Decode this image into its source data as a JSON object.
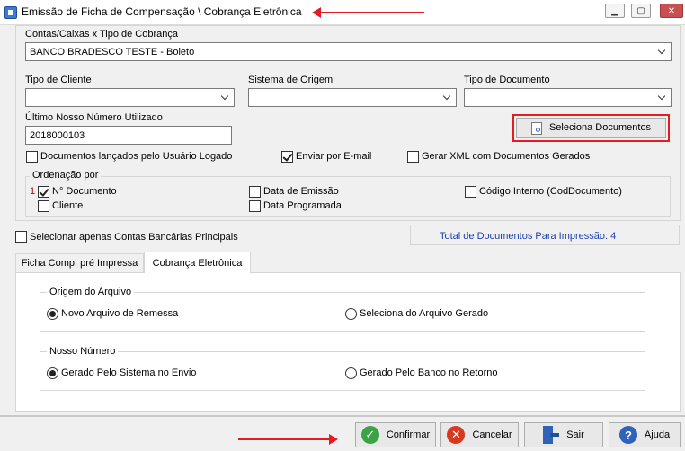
{
  "window": {
    "title": "Emissão de Ficha de Compensação \\ Cobrança Eletrônica",
    "minimize": "▭",
    "maximize": "□",
    "close": "✕"
  },
  "contas": {
    "label": "Contas/Caixas x Tipo de Cobrança",
    "value": "BANCO BRADESCO TESTE - Boleto"
  },
  "filters": {
    "tipo_cliente": {
      "label": "Tipo de Cliente",
      "value": ""
    },
    "sistema_origem": {
      "label": "Sistema de Origem",
      "value": ""
    },
    "tipo_documento": {
      "label": "Tipo de Documento",
      "value": ""
    }
  },
  "ultimo_nosso_numero": {
    "label": "Último Nosso Número Utilizado",
    "value": "2018000103"
  },
  "seleciona_documentos": "Seleciona Documentos",
  "options": {
    "docs_usuario": {
      "label": "Documentos lançados pelo Usuário Logado",
      "checked": false
    },
    "enviar_email": {
      "label": "Enviar por E-mail",
      "checked": true
    },
    "gerar_xml": {
      "label": "Gerar XML com Documentos Gerados",
      "checked": false
    }
  },
  "ordenacao": {
    "label": "Ordenação por",
    "order_index": "1",
    "items": [
      {
        "label": "N° Documento",
        "checked": true
      },
      {
        "label": "Data de Emissão",
        "checked": false
      },
      {
        "label": "Código Interno (CodDocumento)",
        "checked": false
      },
      {
        "label": "Cliente",
        "checked": false
      },
      {
        "label": "Data Programada",
        "checked": false
      }
    ]
  },
  "contas_principais": {
    "label": "Selecionar apenas Contas Bancárias Principais",
    "checked": false
  },
  "total_docs": "Total de Documentos Para Impressão: 4",
  "tabs": [
    {
      "label": "Ficha Comp. pré Impressa",
      "active": false
    },
    {
      "label": "Cobrança Eletrônica",
      "active": true
    }
  ],
  "origem_arquivo": {
    "label": "Origem do Arquivo",
    "options": [
      {
        "label": "Novo Arquivo de Remessa",
        "selected": true
      },
      {
        "label": "Seleciona do Arquivo Gerado",
        "selected": false
      }
    ]
  },
  "nosso_numero": {
    "label": "Nosso Número",
    "options": [
      {
        "label": "Gerado Pelo Sistema no Envio",
        "selected": true
      },
      {
        "label": "Gerado Pelo Banco  no Retorno",
        "selected": false
      }
    ]
  },
  "buttons": {
    "confirmar": "Confirmar",
    "cancelar": "Cancelar",
    "sair": "Sair",
    "ajuda": "Ajuda"
  },
  "colors": {
    "accent_red": "#e31b23",
    "total_text": "#1a3fb0",
    "confirm_green": "#3aa346",
    "cancel_red": "#d9381e",
    "help_blue": "#2f62b8"
  }
}
